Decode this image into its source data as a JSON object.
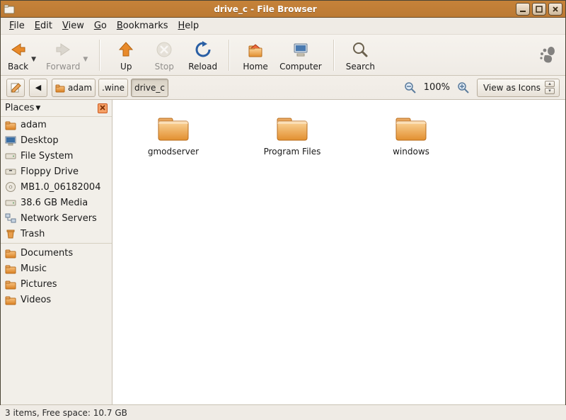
{
  "window": {
    "title": "drive_c - File Browser"
  },
  "menu": {
    "file": "File",
    "edit": "Edit",
    "view": "View",
    "go": "Go",
    "bookmarks": "Bookmarks",
    "help": "Help"
  },
  "toolbar": {
    "back": "Back",
    "forward": "Forward",
    "up": "Up",
    "stop": "Stop",
    "reload": "Reload",
    "home": "Home",
    "computer": "Computer",
    "search": "Search"
  },
  "breadcrumbs": {
    "home": "adam",
    "seg1": ".wine",
    "seg2": "drive_c"
  },
  "zoom": {
    "percent": "100%"
  },
  "viewmode": {
    "label": "View as Icons"
  },
  "sidebar": {
    "header": "Places",
    "items": [
      {
        "label": "adam",
        "icon": "home"
      },
      {
        "label": "Desktop",
        "icon": "desktop"
      },
      {
        "label": "File System",
        "icon": "drive"
      },
      {
        "label": "Floppy Drive",
        "icon": "drive"
      },
      {
        "label": "MB1.0_06182004",
        "icon": "cd"
      },
      {
        "label": "38.6 GB Media",
        "icon": "drive"
      },
      {
        "label": "Network Servers",
        "icon": "network"
      },
      {
        "label": "Trash",
        "icon": "trash"
      }
    ],
    "bookmarks": [
      {
        "label": "Documents"
      },
      {
        "label": "Music"
      },
      {
        "label": "Pictures"
      },
      {
        "label": "Videos"
      }
    ]
  },
  "files": [
    {
      "name": "gmodserver"
    },
    {
      "name": "Program Files"
    },
    {
      "name": "windows"
    }
  ],
  "status": {
    "text": "3 items, Free space: 10.7 GB"
  }
}
